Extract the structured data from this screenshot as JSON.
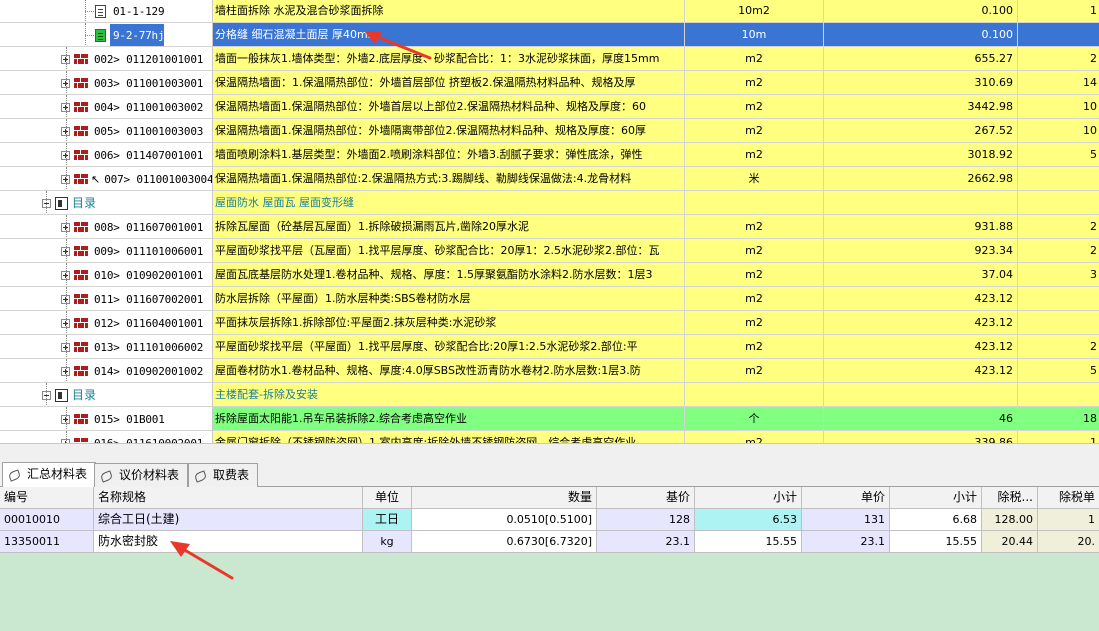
{
  "tree_rows": [
    {
      "kind": "sub",
      "code": "01-1-129",
      "name": "墙柱面拆除 水泥及混合砂浆面拆除",
      "unit": "10m2",
      "qty": "0.100",
      "extra": "1"
    },
    {
      "kind": "sub-selected",
      "code": "9-2-77hj",
      "name": "分格缝 细石混凝土面层 厚40mm",
      "unit": "10m",
      "qty": "0.100",
      "extra": ""
    },
    {
      "kind": "item",
      "code": "002> 011201001001",
      "name": "墙面一般抹灰1.墙体类型：外墙2.底层厚度、砂浆配合比：1：3水泥砂浆抹面，厚度15mm",
      "unit": "m2",
      "qty": "655.27",
      "extra": "2"
    },
    {
      "kind": "item",
      "code": "003> 011001003001",
      "name": "保温隔热墙面：1.保温隔热部位：外墙首层部位 挤塑板2.保温隔热材料品种、规格及厚",
      "unit": "m2",
      "qty": "310.69",
      "extra": "14"
    },
    {
      "kind": "item",
      "code": "004> 011001003002",
      "name": "保温隔热墙面1.保温隔热部位：外墙首层以上部位2.保温隔热材料品种、规格及厚度：60",
      "unit": "m2",
      "qty": "3442.98",
      "extra": "10"
    },
    {
      "kind": "item",
      "code": "005> 011001003003",
      "name": "保温隔热墙面1.保温隔热部位：外墙隔离带部位2.保温隔热材料品种、规格及厚度：60厚",
      "unit": "m2",
      "qty": "267.52",
      "extra": "10"
    },
    {
      "kind": "item",
      "code": "006> 011407001001",
      "name": "墙面喷刷涂料1.基层类型：外墙面2.喷刷涂料部位：外墙3.刮腻子要求：弹性底涂，弹性",
      "unit": "m2",
      "qty": "3018.92",
      "extra": "5"
    },
    {
      "kind": "item-cursor",
      "code": "007> 011001003004",
      "name": "保温隔热墙面1.保温隔热部位:2.保温隔热方式:3.踢脚线、勒脚线保温做法:4.龙骨材料",
      "unit": "米",
      "qty": "2662.98",
      "extra": ""
    },
    {
      "kind": "dir",
      "code": "目录",
      "name": "屋面防水 屋面瓦  屋面变形缝",
      "unit": "",
      "qty": "",
      "extra": ""
    },
    {
      "kind": "item",
      "code": "008> 011607001001",
      "name": "拆除瓦屋面（砼基层瓦屋面）1.拆除破损漏雨瓦片,凿除20厚水泥",
      "unit": "m2",
      "qty": "931.88",
      "extra": "2"
    },
    {
      "kind": "item",
      "code": "009> 011101006001",
      "name": "平屋面砂浆找平层（瓦屋面）1.找平层厚度、砂浆配合比：20厚1：2.5水泥砂浆2.部位：瓦",
      "unit": "m2",
      "qty": "923.34",
      "extra": "2"
    },
    {
      "kind": "item",
      "code": "010> 010902001001",
      "name": "屋面瓦底基层防水处理1.卷材品种、规格、厚度：1.5厚聚氨酯防水涂料2.防水层数：1层3",
      "unit": "m2",
      "qty": "37.04",
      "extra": "3"
    },
    {
      "kind": "item",
      "code": "011> 011607002001",
      "name": "防水层拆除（平屋面）1.防水层种类:SBS卷材防水层",
      "unit": "m2",
      "qty": "423.12",
      "extra": ""
    },
    {
      "kind": "item",
      "code": "012> 011604001001",
      "name": "平面抹灰层拆除1.拆除部位:平屋面2.抹灰层种类:水泥砂浆",
      "unit": "m2",
      "qty": "423.12",
      "extra": ""
    },
    {
      "kind": "item",
      "code": "013> 011101006002",
      "name": "平屋面砂浆找平层（平屋面）1.找平层厚度、砂浆配合比:20厚1:2.5水泥砂浆2.部位:平",
      "unit": "m2",
      "qty": "423.12",
      "extra": "2"
    },
    {
      "kind": "item",
      "code": "014> 010902001002",
      "name": "屋面卷材防水1.卷材品种、规格、厚度:4.0厚SBS改性沥青防水卷材2.防水层数:1层3.防",
      "unit": "m2",
      "qty": "423.12",
      "extra": "5"
    },
    {
      "kind": "dir",
      "code": "目录",
      "name": "主楼配套-拆除及安装",
      "unit": "",
      "qty": "",
      "extra": ""
    },
    {
      "kind": "item-green",
      "code": "015> 01B001",
      "name": "拆除屋面太阳能1.吊车吊装拆除2.综合考虑高空作业",
      "unit": "个",
      "qty": "46",
      "extra": "18"
    },
    {
      "kind": "item",
      "code": "016> 011610002001",
      "name": "金属门窗拆除（不锈钢防盗网）1.室内高度:拆除外墙不锈钢防盗网，综合考虑高空作业",
      "unit": "m2",
      "qty": "339.86",
      "extra": "1"
    }
  ],
  "tabs": [
    {
      "label": "汇总材料表",
      "active": true
    },
    {
      "label": "议价材料表",
      "active": false
    },
    {
      "label": "取费表",
      "active": false
    }
  ],
  "mat_headers": [
    "编号",
    "名称规格",
    "单位",
    "数量",
    "基价",
    "小计",
    "单价",
    "小计",
    "除税...",
    "除税单"
  ],
  "mat_rows": [
    {
      "code": "00010010",
      "name": "综合工日(土建)",
      "unit": "工日",
      "qty": "0.0510[0.5100]",
      "base": "128",
      "sub1": "6.53",
      "price": "131",
      "sub2": "6.68",
      "tax": "128.00",
      "taxu": "1"
    },
    {
      "code": "13350011",
      "name": "防水密封胶",
      "unit": "kg",
      "qty": "0.6730[6.7320]",
      "base": "23.1",
      "sub1": "15.55",
      "price": "23.1",
      "sub2": "15.55",
      "tax": "20.44",
      "taxu": "20."
    }
  ],
  "colors": {
    "selected": "#3a75d4",
    "row_yellow": "#ffff80",
    "row_green": "#80ff80",
    "dir_text": "#1a7f9a",
    "annotation": "#e8382a",
    "bottom_bg": "#c9e8cf"
  }
}
